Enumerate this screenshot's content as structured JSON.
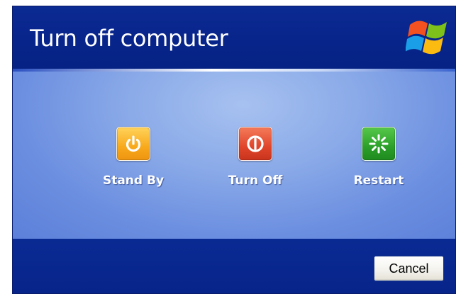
{
  "dialog": {
    "title": "Turn off computer",
    "logo_icon": "windows-flag-icon"
  },
  "options": [
    {
      "label": "Stand By",
      "icon": "standby-power-icon",
      "color": "#f8a91c"
    },
    {
      "label": "Turn Off",
      "icon": "turn-off-power-icon",
      "color": "#e0452a"
    },
    {
      "label": "Restart",
      "icon": "restart-icon",
      "color": "#2b9f29"
    }
  ],
  "footer": {
    "cancel_label": "Cancel"
  }
}
